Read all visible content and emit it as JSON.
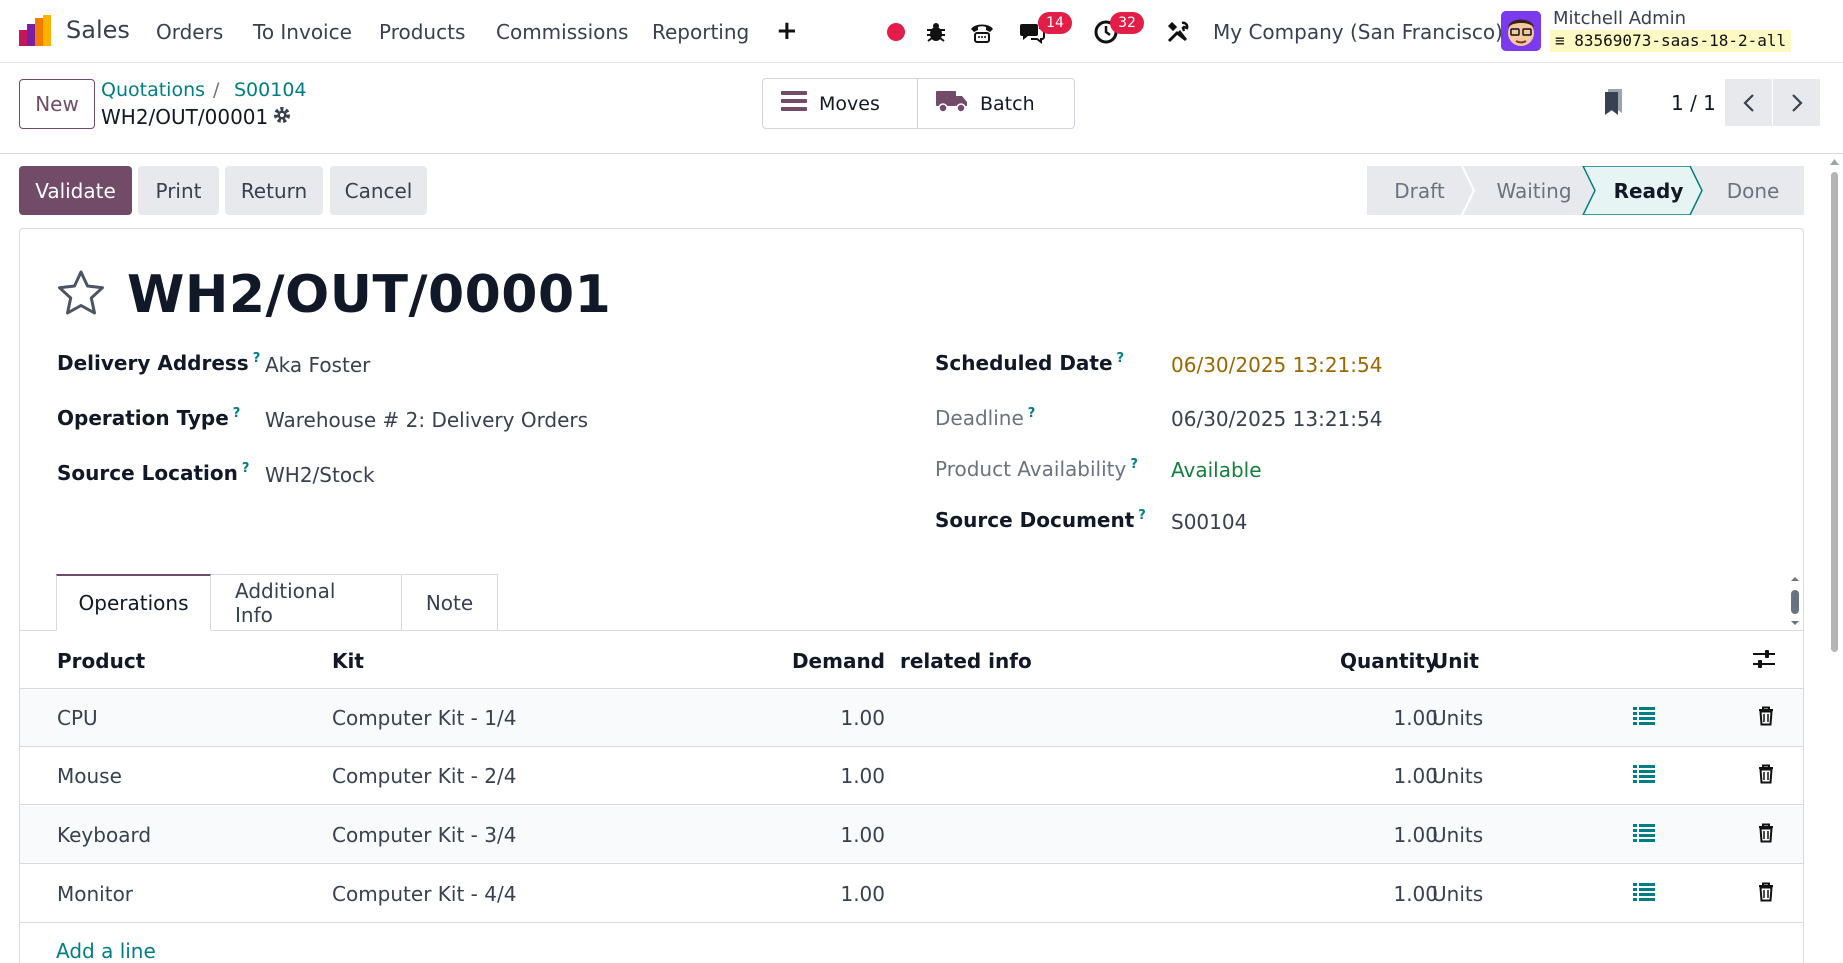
{
  "nav": {
    "app_name": "Sales",
    "menu": [
      "Orders",
      "To Invoice",
      "Products",
      "Commissions",
      "Reporting"
    ],
    "plus_symbol": "+",
    "messages_badge": "14",
    "activities_badge": "32",
    "company": "My Company (San Francisco)",
    "user_name": "Mitchell Admin",
    "db_name": "83569073-saas-18-2-all"
  },
  "control_panel": {
    "new_label": "New",
    "breadcrumbs": [
      "Quotations",
      "S00104"
    ],
    "breadcrumb_separator": "/",
    "record_name": "WH2/OUT/00001",
    "smart_buttons": [
      {
        "label": "Moves",
        "icon": "list-icon"
      },
      {
        "label": "Batch",
        "icon": "truck-icon"
      }
    ],
    "pager": "1 / 1"
  },
  "actions": {
    "validate": "Validate",
    "print": "Print",
    "return": "Return",
    "cancel": "Cancel"
  },
  "statusbar": {
    "stages": [
      "Draft",
      "Waiting",
      "Ready",
      "Done"
    ],
    "current": "Ready"
  },
  "form": {
    "title": "WH2/OUT/00001",
    "help_mark": "?",
    "left_fields": [
      {
        "label": "Delivery Address",
        "value": "Aka Foster"
      },
      {
        "label": "Operation Type",
        "value": "Warehouse # 2: Delivery Orders"
      },
      {
        "label": "Source Location",
        "value": "WH2/Stock"
      }
    ],
    "right_fields": [
      {
        "label": "Scheduled Date",
        "value": "06/30/2025 13:21:54"
      },
      {
        "label": "Deadline",
        "value": "06/30/2025 13:21:54"
      },
      {
        "label": "Product Availability",
        "value": "Available"
      },
      {
        "label": "Source Document",
        "value": "S00104"
      }
    ]
  },
  "tabs": [
    "Operations",
    "Additional Info",
    "Note"
  ],
  "table": {
    "headers": {
      "product": "Product",
      "kit": "Kit",
      "demand": "Demand",
      "related": "related info",
      "quantity": "Quantity",
      "unit": "Unit"
    },
    "rows": [
      {
        "product": "CPU",
        "kit": "Computer Kit - 1/4",
        "demand": "1.00",
        "quantity": "1.00",
        "unit": "Units"
      },
      {
        "product": "Mouse",
        "kit": "Computer Kit - 2/4",
        "demand": "1.00",
        "quantity": "1.00",
        "unit": "Units"
      },
      {
        "product": "Keyboard",
        "kit": "Computer Kit - 3/4",
        "demand": "1.00",
        "quantity": "1.00",
        "unit": "Units"
      },
      {
        "product": "Monitor",
        "kit": "Computer Kit - 4/4",
        "demand": "1.00",
        "quantity": "1.00",
        "unit": "Units"
      }
    ],
    "add_line": "Add a line"
  },
  "colors": {
    "brand": "#714b67",
    "link": "#017e84",
    "badge": "#e11d48",
    "scheduled_date": "#9a6700",
    "available": "#15803d",
    "record_dot": "#e11d48"
  }
}
